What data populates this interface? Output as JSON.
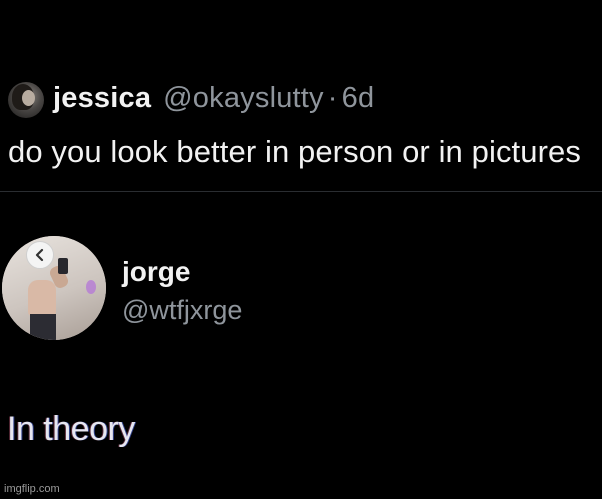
{
  "tweet": {
    "author_name": "jessica",
    "author_handle": "@okayslutty",
    "separator": "·",
    "time": "6d",
    "text": "do you look better in person or in pictures"
  },
  "profile": {
    "name": "jorge",
    "handle": "@wtfjxrge",
    "back_icon": "chevron-left-icon"
  },
  "reply": {
    "text": "In theory"
  },
  "watermark": {
    "text": "imgflip.com"
  },
  "colors": {
    "background": "#000000",
    "primary_text": "#f2f2f2",
    "secondary_text": "#8f959c"
  }
}
